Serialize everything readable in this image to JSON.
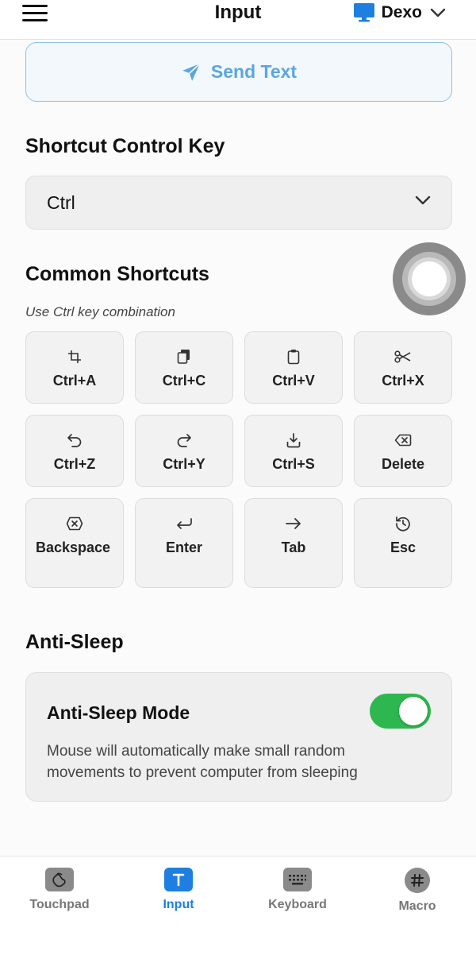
{
  "header": {
    "menu_icon": "hamburger-menu-icon",
    "title": "Input",
    "device_icon": "monitor-icon",
    "device_name": "Dexo",
    "device_chevron_icon": "chevron-down-icon"
  },
  "send_text": {
    "icon": "paper-plane-icon",
    "label": "Send Text"
  },
  "shortcut_control": {
    "title": "Shortcut Control Key",
    "selected": "Ctrl",
    "chevron_icon": "chevron-down-icon"
  },
  "common_shortcuts": {
    "title": "Common Shortcuts",
    "hint": "Use Ctrl key combination",
    "keys": [
      {
        "label": "Ctrl+A",
        "icon": "crop-icon"
      },
      {
        "label": "Ctrl+C",
        "icon": "copy-icon"
      },
      {
        "label": "Ctrl+V",
        "icon": "clipboard-icon"
      },
      {
        "label": "Ctrl+X",
        "icon": "scissors-icon"
      },
      {
        "label": "Ctrl+Z",
        "icon": "undo-icon"
      },
      {
        "label": "Ctrl+Y",
        "icon": "redo-icon"
      },
      {
        "label": "Ctrl+S",
        "icon": "save-icon"
      },
      {
        "label": "Delete",
        "icon": "delete-icon"
      },
      {
        "label": "Backspace",
        "icon": "backspace-icon"
      },
      {
        "label": "Enter",
        "icon": "enter-icon"
      },
      {
        "label": "Tab",
        "icon": "arrow-right-icon"
      },
      {
        "label": "Esc",
        "icon": "rotate-icon"
      }
    ]
  },
  "anti_sleep": {
    "section_title": "Anti-Sleep",
    "mode_title": "Anti-Sleep Mode",
    "description": "Mouse will automatically make small random movements to prevent computer from sleeping",
    "enabled": true,
    "toggle_color": "#2eb64f"
  },
  "tabs": [
    {
      "label": "Touchpad",
      "icon": "touchpad-icon",
      "active": false
    },
    {
      "label": "Input",
      "icon": "text-input-icon",
      "active": true
    },
    {
      "label": "Keyboard",
      "icon": "keyboard-icon",
      "active": false
    },
    {
      "label": "Macro",
      "icon": "hash-icon",
      "active": false
    }
  ],
  "colors": {
    "accent": "#1f7fe0",
    "send_text": "#5aa6e3",
    "toggle_on": "#2eb64f"
  }
}
